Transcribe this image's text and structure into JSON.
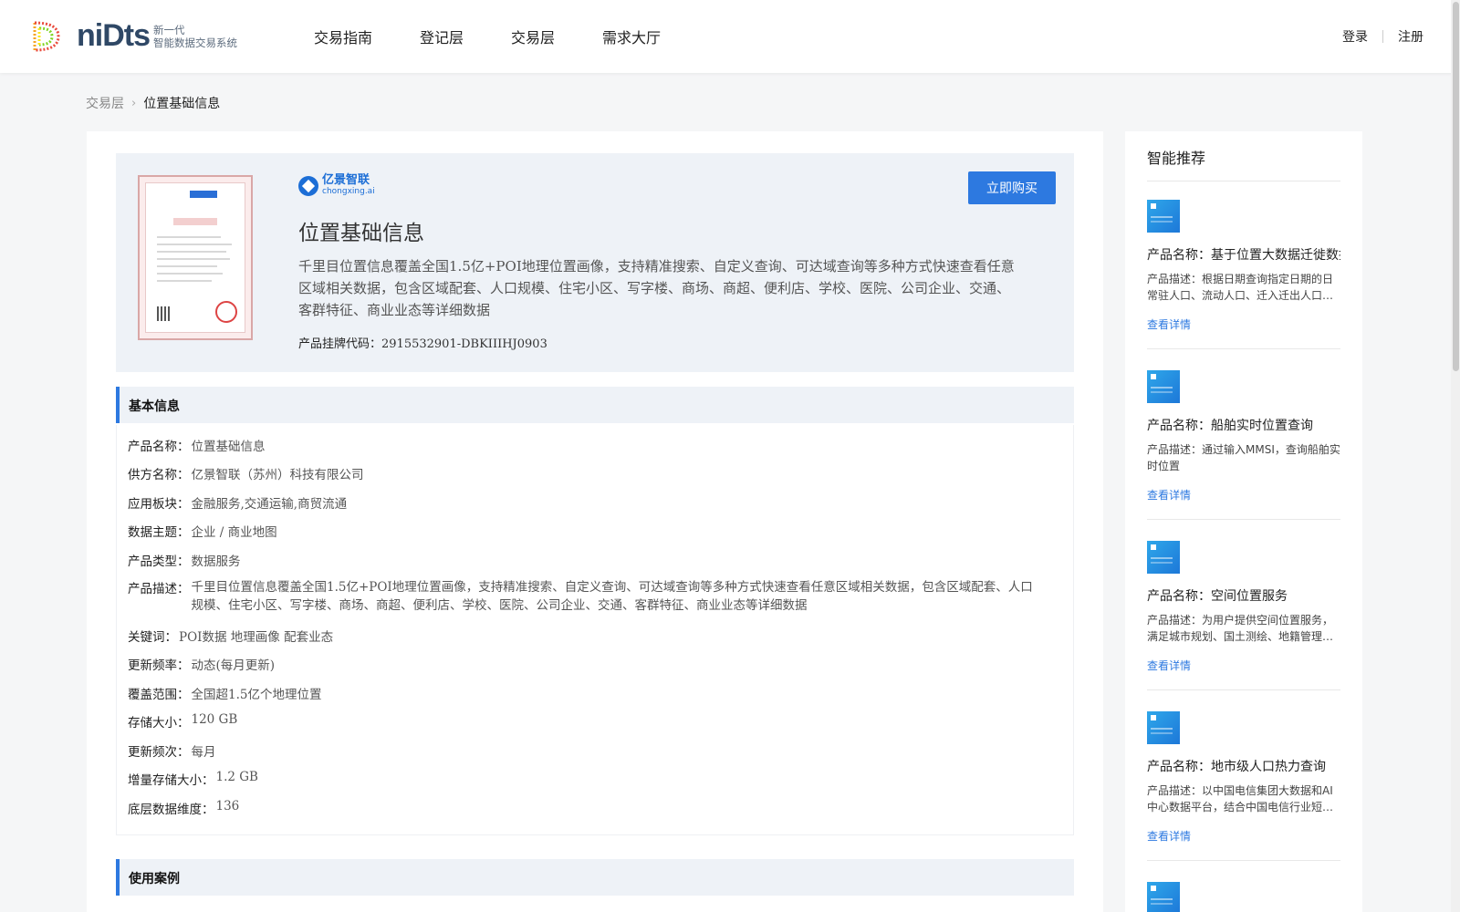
{
  "header": {
    "logo_text": "niDts",
    "logo_sub_1": "新一代",
    "logo_sub_2": "智能数据交易系统",
    "nav": [
      "交易指南",
      "登记层",
      "交易层",
      "需求大厅"
    ],
    "login": "登录",
    "register": "注册"
  },
  "breadcrumb": {
    "parent": "交易层",
    "current": "位置基础信息"
  },
  "product": {
    "vendor_name": "亿景智联",
    "vendor_url": "chongxing.ai",
    "buy_label": "立即购买",
    "title": "位置基础信息",
    "description": "千里目位置信息覆盖全国1.5亿+POI地理位置画像，支持精准搜索、自定义查询、可达域查询等多种方式快速查看任意区域相关数据，包含区域配套、人口规模、住宅小区、写字楼、商场、商超、便利店、学校、医院、公司企业、交通、客群特征、商业业态等详细数据",
    "code_label": "产品挂牌代码：",
    "code_value": "2915532901-DBKIIIHJ0903"
  },
  "basic_info": {
    "title": "基本信息",
    "rows": [
      {
        "k": "产品名称：",
        "v": "位置基础信息"
      },
      {
        "k": "供方名称：",
        "v": "亿景智联（苏州）科技有限公司"
      },
      {
        "k": "应用板块：",
        "v": "金融服务,交通运输,商贸流通"
      },
      {
        "k": "数据主题：",
        "v": "企业 / 商业地图"
      },
      {
        "k": "产品类型：",
        "v": "数据服务"
      },
      {
        "k": "产品描述：",
        "v": "千里目位置信息覆盖全国1.5亿+POI地理位置画像，支持精准搜索、自定义查询、可达域查询等多种方式快速查看任意区域相关数据，包含区域配套、人口规模、住宅小区、写字楼、商场、商超、便利店、学校、医院、公司企业、交通、客群特征、商业业态等详细数据"
      },
      {
        "k": "关键词：",
        "v": "POI数据 地理画像 配套业态"
      },
      {
        "k": "更新频率：",
        "v": "动态(每月更新)"
      },
      {
        "k": "覆盖范围：",
        "v": "全国超1.5亿个地理位置"
      },
      {
        "k": "存储大小：",
        "v": "120 GB"
      },
      {
        "k": "更新频次：",
        "v": "每月"
      },
      {
        "k": "增量存储大小：",
        "v": "1.2 GB"
      },
      {
        "k": "底层数据维度：",
        "v": "136"
      }
    ]
  },
  "use_cases": {
    "title": "使用案例"
  },
  "sidebar": {
    "title": "智能推荐",
    "link_label": "查看详情",
    "items": [
      {
        "name": "产品名称：基于位置大数据迁徙数据",
        "desc": "产品描述：根据日期查询指定日期的日常驻人口、流动人口、迁入迁出人口…"
      },
      {
        "name": "产品名称：船舶实时位置查询",
        "desc": "产品描述：通过输入MMSI，查询船舶实时位置"
      },
      {
        "name": "产品名称：空间位置服务",
        "desc": "产品描述：为用户提供空间位置服务，满足城市规划、国土测绘、地籍管理…"
      },
      {
        "name": "产品名称：地市级人口热力查询",
        "desc": "产品描述：以中国电信集团大数据和AI中心数据平台，结合中国电信行业短…"
      }
    ]
  }
}
